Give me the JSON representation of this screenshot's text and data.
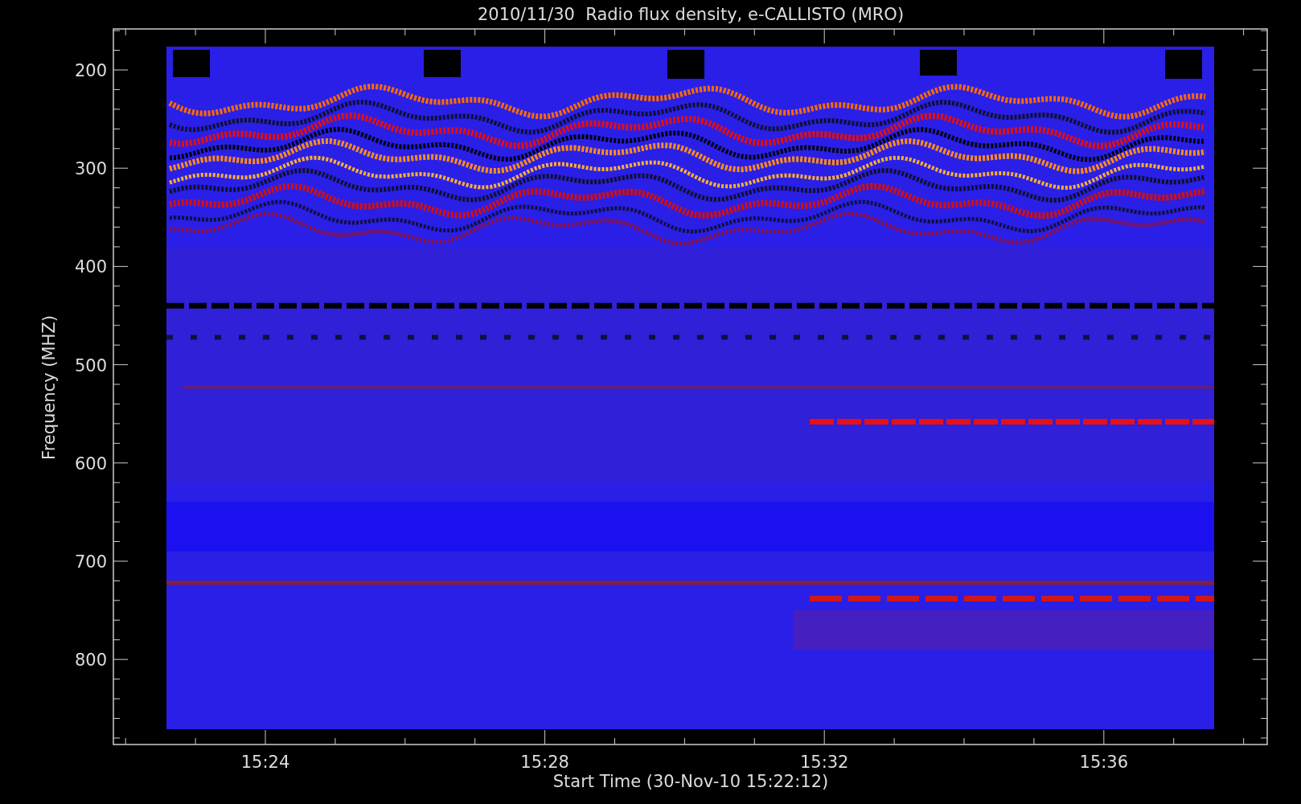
{
  "title": "2010/11/30  Radio flux density, e-CALLISTO (MRO)",
  "y_axis": {
    "label": "Frequency (MHZ)",
    "ticks": [
      "200",
      "300",
      "400",
      "500",
      "600",
      "700",
      "800"
    ]
  },
  "x_axis": {
    "label": "Start Time (30-Nov-10 15:22:12)",
    "ticks": [
      "15:24",
      "15:28",
      "15:32",
      "15:36"
    ]
  }
}
